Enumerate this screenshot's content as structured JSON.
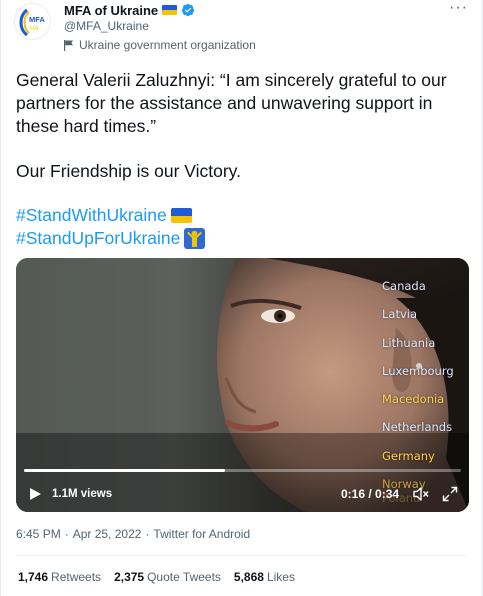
{
  "author": {
    "name": "MFA of Ukraine",
    "handle": "@MFA_Ukraine",
    "affiliation": "Ukraine government organization",
    "avatar_text": "MFA",
    "avatar_sub": "UA"
  },
  "tweet": {
    "quote": "General Valerii Zaluzhnyi: “I am sincerely grateful to our partners for the assistance and unwavering support in these hard times.”",
    "line2": "Our Friendship is our Victory.",
    "hashtags": [
      "#StandWithUkraine",
      "#StandUpForUkraine"
    ]
  },
  "video": {
    "countries": [
      "Canada",
      "Latvia",
      "Lithuania",
      "Luxembourg",
      "Macedonia",
      "Netherlands",
      "Germany",
      "Norway",
      "Poland"
    ],
    "views": "1.1M views",
    "time": "0:16 / 0:34",
    "progress": 0.46
  },
  "meta": {
    "time": "6:45 PM",
    "date": "Apr 25, 2022",
    "source": "Twitter for Android",
    "separator": "·"
  },
  "stats": {
    "retweets_count": "1,746",
    "retweets_label": "Retweets",
    "quotes_count": "2,375",
    "quotes_label": "Quote Tweets",
    "likes_count": "5,868",
    "likes_label": "Likes"
  },
  "colors": {
    "accent": "#1d9bf0",
    "flag_blue": "#1f5bd8",
    "flag_yellow": "#f5c400",
    "muted": "#536471"
  }
}
